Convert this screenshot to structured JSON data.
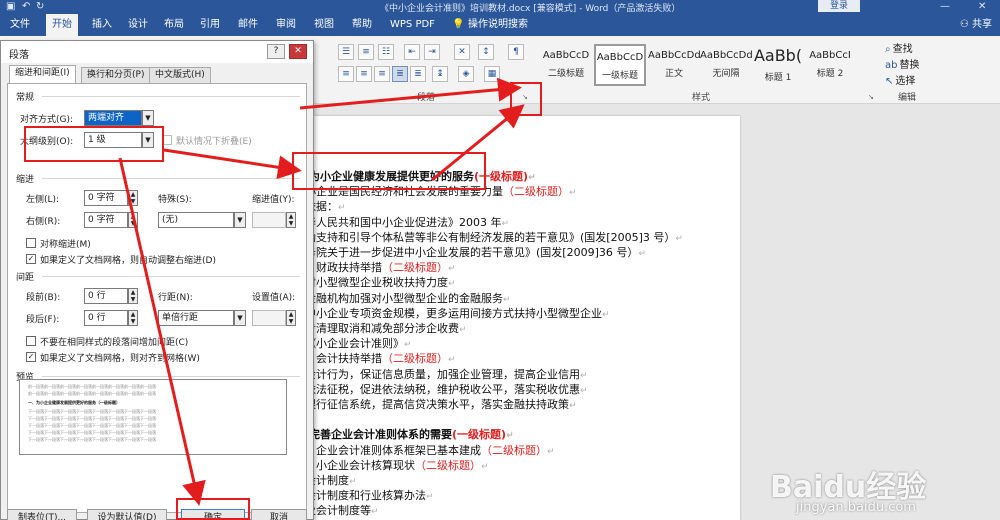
{
  "title_bar": {
    "text": "《中小企业会计准则》培训教材.docx [兼容模式] - Word（产品激活失败）",
    "login": "登录"
  },
  "tabs": [
    "文件",
    "开始",
    "插入",
    "设计",
    "布局",
    "引用",
    "邮件",
    "审阅",
    "视图",
    "帮助",
    "WPS PDF",
    "操作说明搜索"
  ],
  "share": "共享",
  "ribbon": {
    "paragraph_group": "段落",
    "styles_group": "样式",
    "editing_group": "编辑",
    "styles": [
      {
        "sample": "AaBbCcD",
        "name": "二级标题"
      },
      {
        "sample": "AaBbCcD",
        "name": "一级标题"
      },
      {
        "sample": "AaBbCcDd",
        "name": "正文"
      },
      {
        "sample": "AaBbCcDd",
        "name": "无间隔"
      },
      {
        "sample": "AaBb(",
        "name": "标题 1"
      },
      {
        "sample": "AaBbCcI",
        "name": "标题 2"
      }
    ],
    "editing": [
      "查找",
      "替换",
      "选择"
    ]
  },
  "dialog": {
    "title": "段落",
    "tabs": [
      "缩进和间距(I)",
      "换行和分页(P)",
      "中文版式(H)"
    ],
    "general": "常规",
    "alignment_label": "对齐方式(G):",
    "alignment_value": "两端对齐",
    "outline_label": "大纲级别(O):",
    "outline_value": "1 级",
    "collapse_label": "默认情况下折叠(E)",
    "indent": "缩进",
    "left_label": "左侧(L):",
    "left_value": "0 字符",
    "right_label": "右侧(R):",
    "right_value": "0 字符",
    "special_label": "特殊(S):",
    "special_value": "(无)",
    "indent_by_label": "缩进值(Y):",
    "mirror_label": "对称缩进(M)",
    "auto_indent_label": "如果定义了文档网格，则自动调整右缩进(D)",
    "spacing": "间距",
    "before_label": "段前(B):",
    "before_value": "0 行",
    "after_label": "段后(F):",
    "after_value": "0 行",
    "line_label": "行距(N):",
    "line_value": "单倍行距",
    "at_label": "设置值(A):",
    "no_space_label": "不要在相同样式的段落间增加间距(C)",
    "snap_grid_label": "如果定义了文档网格，则对齐到网格(W)",
    "preview": "预览",
    "preview_text": {
      "prev": "前一段落前一段落前一段落前一段落前一段落前一段落前一段落前一段落",
      "current": "一、为小企业健康发展提供更好的服务（一级标题）",
      "next": "下一段落下一段落下一段落下一段落下一段落下一段落下一段落下一段落"
    },
    "buttons": {
      "tabs": "制表位(T)...",
      "default": "设为默认值(D)",
      "ok": "确定",
      "cancel": "取消"
    }
  },
  "document": {
    "lines": [
      {
        "text": "为小企业健康发展提供更好的服务",
        "tag": "(一级标题)",
        "bold": true
      },
      {
        "text": "小企业是国民经济和社会发展的重要力量",
        "tag": "（二级标题）"
      },
      {
        "text": "依据：",
        "tag": ""
      },
      {
        "text": "华人民共和国中小企业促进法》2003 年",
        "tag": ""
      },
      {
        "text": "励支持和引导个体私营等非公有制经济发展的若干意见》(国发[2005]3 号）",
        "tag": ""
      },
      {
        "text": "务院关于进一步促进中小企业发展的若干意见》(国发[2009]36 号）",
        "tag": ""
      },
      {
        "text": "、财政扶持举措",
        "tag": "（二级标题）"
      },
      {
        "text": "对小型微型企业税收扶持力度",
        "tag": ""
      },
      {
        "text": "金融机构加强对小型微型企业的金融服务",
        "tag": ""
      },
      {
        "text": "中小企业专项资金规模，更多运用间接方式扶持小型微型企业",
        "tag": ""
      },
      {
        "text": "步清理取消和减免部分涉企收费",
        "tag": ""
      },
      {
        "text": "《小企业会计准则》",
        "tag": ""
      },
      {
        "text": "、会计扶持举措",
        "tag": "（二级标题）"
      },
      {
        "text": "会计行为，保证信息质量，加强企业管理，提高企业信用",
        "tag": ""
      },
      {
        "text": "依法征税，促进依法纳税，维护税收公平，落实税收优惠",
        "tag": ""
      },
      {
        "text": "银行征信系统，提高信贷决策水平，落实金融扶持政策",
        "tag": ""
      },
      {
        "text": "",
        "tag": ""
      },
      {
        "text": "完善企业会计准则体系的需要",
        "tag": "(一级标题)",
        "bold": true
      },
      {
        "text": "、企业会计准则体系框架已基本建成",
        "tag": "（二级标题）"
      },
      {
        "text": "、小企业会计核算现状",
        "tag": "（二级标题）"
      },
      {
        "text": "会计制度",
        "tag": ""
      },
      {
        "text": "会计制度和行业核算办法",
        "tag": ""
      },
      {
        "text": "业会计制度等",
        "tag": ""
      }
    ]
  },
  "watermark": {
    "brand": "Baidu经验",
    "url": "jingyan.baidu.com"
  },
  "colors": {
    "word_blue": "#2b579a",
    "annotation_red": "#e31d1d",
    "heading_red": "#e02020"
  }
}
